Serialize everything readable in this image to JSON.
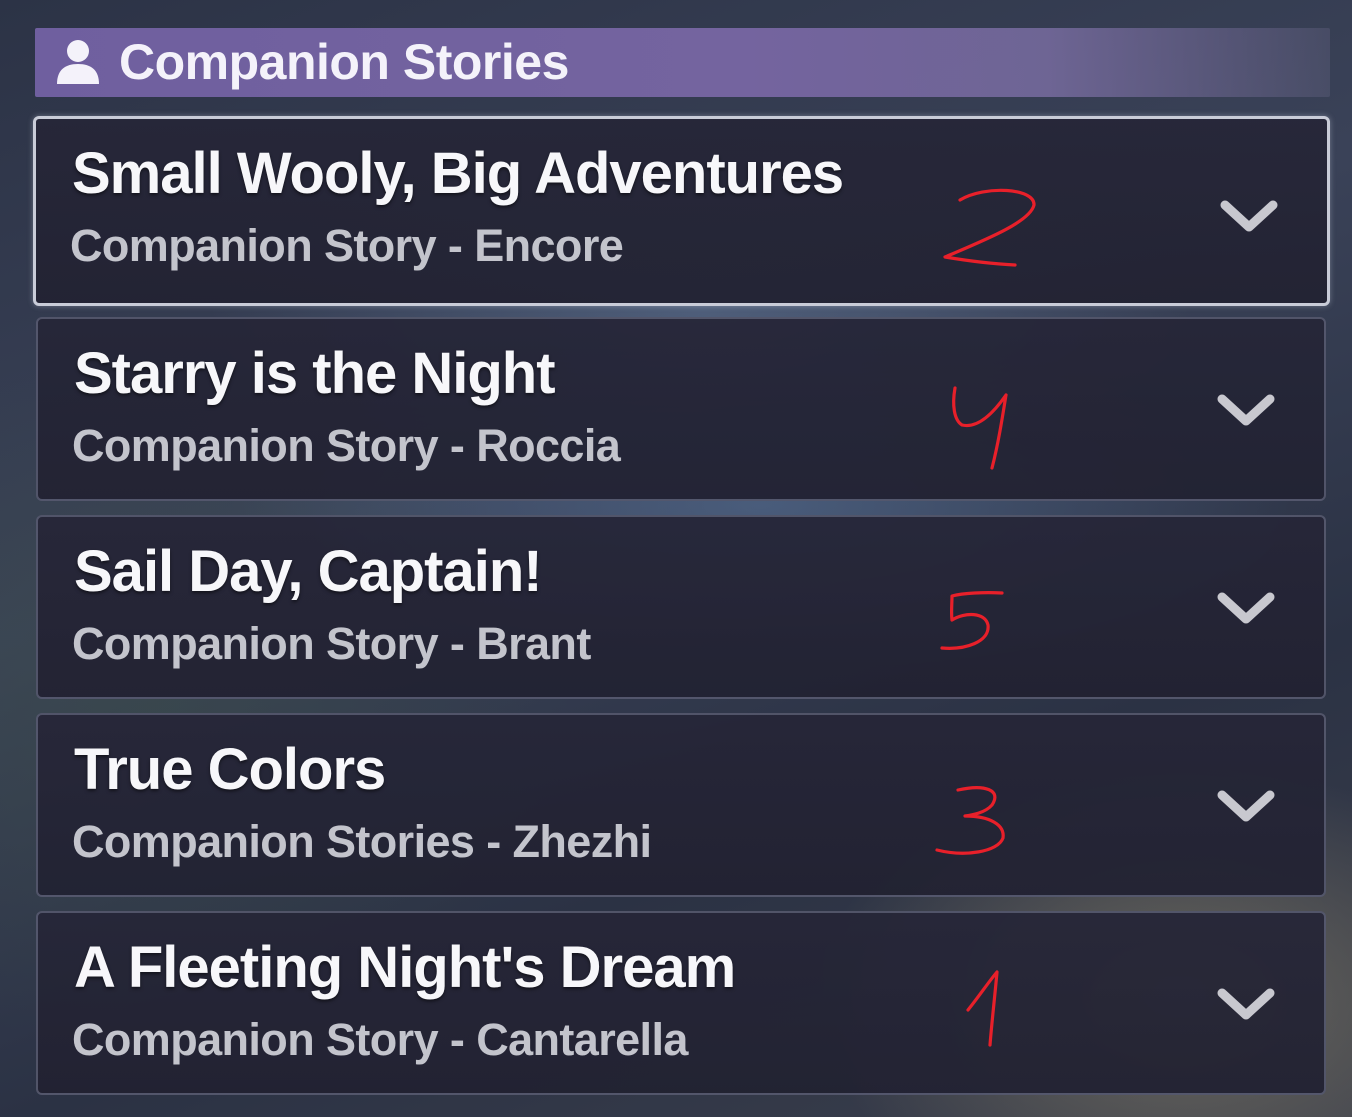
{
  "header": {
    "icon": "person-icon",
    "title": "Companion Stories"
  },
  "stories": [
    {
      "title": "Small Wooly, Big Adventures",
      "subtitle": "Companion Story - Encore",
      "annotation": "2",
      "selected": true
    },
    {
      "title": "Starry is the Night",
      "subtitle": "Companion Story - Roccia",
      "annotation": "4",
      "selected": false
    },
    {
      "title": "Sail Day, Captain!",
      "subtitle": "Companion Story - Brant",
      "annotation": "5",
      "selected": false
    },
    {
      "title": "True Colors",
      "subtitle": "Companion Stories - Zhezhi",
      "annotation": "3",
      "selected": false
    },
    {
      "title": "A Fleeting Night's Dream",
      "subtitle": "Companion Story - Cantarella",
      "annotation": "1",
      "selected": false
    }
  ],
  "colors": {
    "header_bg": "#74649f",
    "card_bg": "#242436",
    "selected_border": "#c9ccd8",
    "title_text": "#f7f7fa",
    "subtitle_text": "#c3c4cc",
    "chevron": "#c8c8cf",
    "annotation_ink": "#e8202a"
  }
}
